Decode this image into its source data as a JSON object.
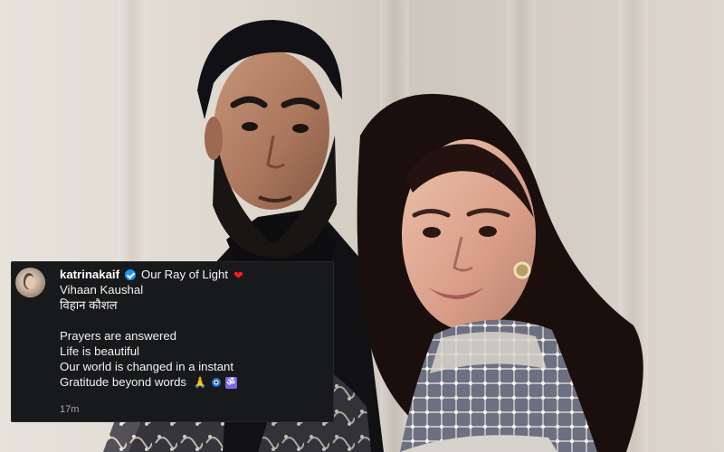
{
  "post": {
    "username": "katrinakaif",
    "title": "Our Ray of Light",
    "baby_name_english": "Vihaan Kaushal",
    "baby_name_hindi": "विहान कौशल",
    "lines": [
      "Prayers are answered",
      "Life is beautiful",
      "Our world is changed in a instant",
      "Gratitude beyond words"
    ],
    "time": "17m",
    "icons": {
      "verified": "verified-icon",
      "heart": "heart-icon",
      "pray": "pray-icon",
      "nazar": "nazar-icon",
      "om": "om-icon"
    },
    "colors": {
      "card_background": "#18191b",
      "verified": "#1c96f0",
      "heart": "#ee1d2b",
      "timestamp": "#a8a8a8"
    }
  }
}
